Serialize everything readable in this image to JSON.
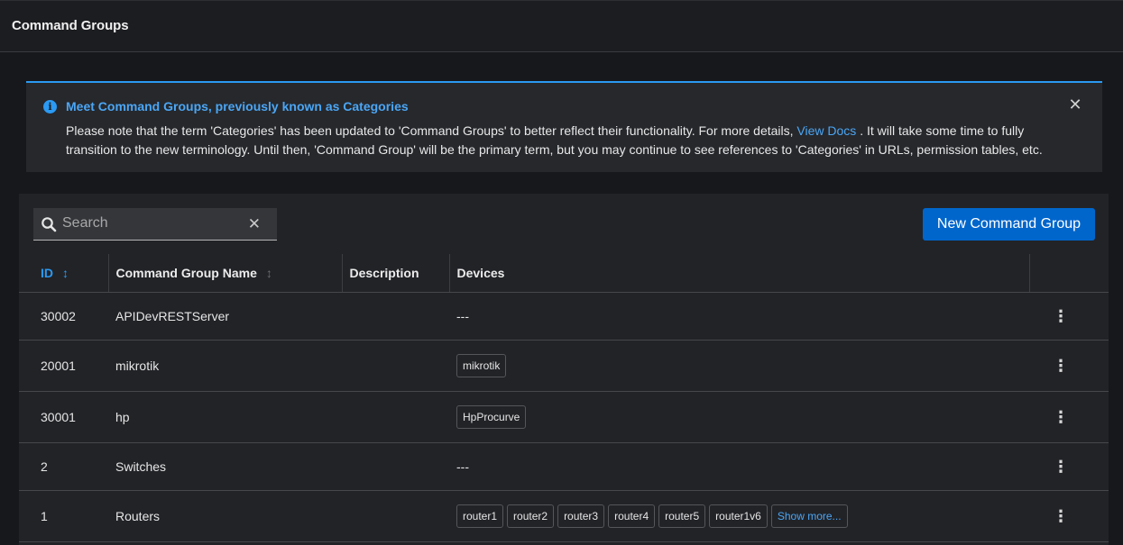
{
  "header": {
    "title": "Command Groups"
  },
  "alert": {
    "title": "Meet Command Groups, previously known as Categories",
    "body_part1": "Please note that the term 'Categories' has been updated to 'Command Groups' to better reflect their functionality. For more details, ",
    "link_label": "View Docs",
    "body_part2": " . It will take some time to fully transition to the new terminology. Until then, 'Command Group' will be the primary term, but you may continue to see references to 'Categories' in URLs, permission tables, etc.",
    "close_icon": "close-icon",
    "info_icon": "info-icon"
  },
  "toolbar": {
    "search_placeholder": "Search",
    "search_value": "",
    "new_button_label": "New Command Group"
  },
  "table": {
    "columns": [
      "ID",
      "Command Group Name",
      "Description",
      "Devices",
      ""
    ],
    "rows": [
      {
        "id": "30002",
        "name": "APIDevRESTServer",
        "description": "",
        "devices_text": "---",
        "devices": []
      },
      {
        "id": "20001",
        "name": "mikrotik",
        "description": "",
        "devices_text": "",
        "devices": [
          "mikrotik"
        ]
      },
      {
        "id": "30001",
        "name": "hp",
        "description": "",
        "devices_text": "",
        "devices": [
          "HpProcurve"
        ]
      },
      {
        "id": "2",
        "name": "Switches",
        "description": "",
        "devices_text": "---",
        "devices": []
      },
      {
        "id": "1",
        "name": "Routers",
        "description": "",
        "devices_text": "",
        "devices": [
          "router1",
          "router2",
          "router3",
          "router4",
          "router5",
          "router1v6"
        ],
        "show_more_label": "Show more..."
      }
    ]
  },
  "colors": {
    "accent": "#2b9af3",
    "primary_button": "#0066cc",
    "background": "#17181b"
  }
}
